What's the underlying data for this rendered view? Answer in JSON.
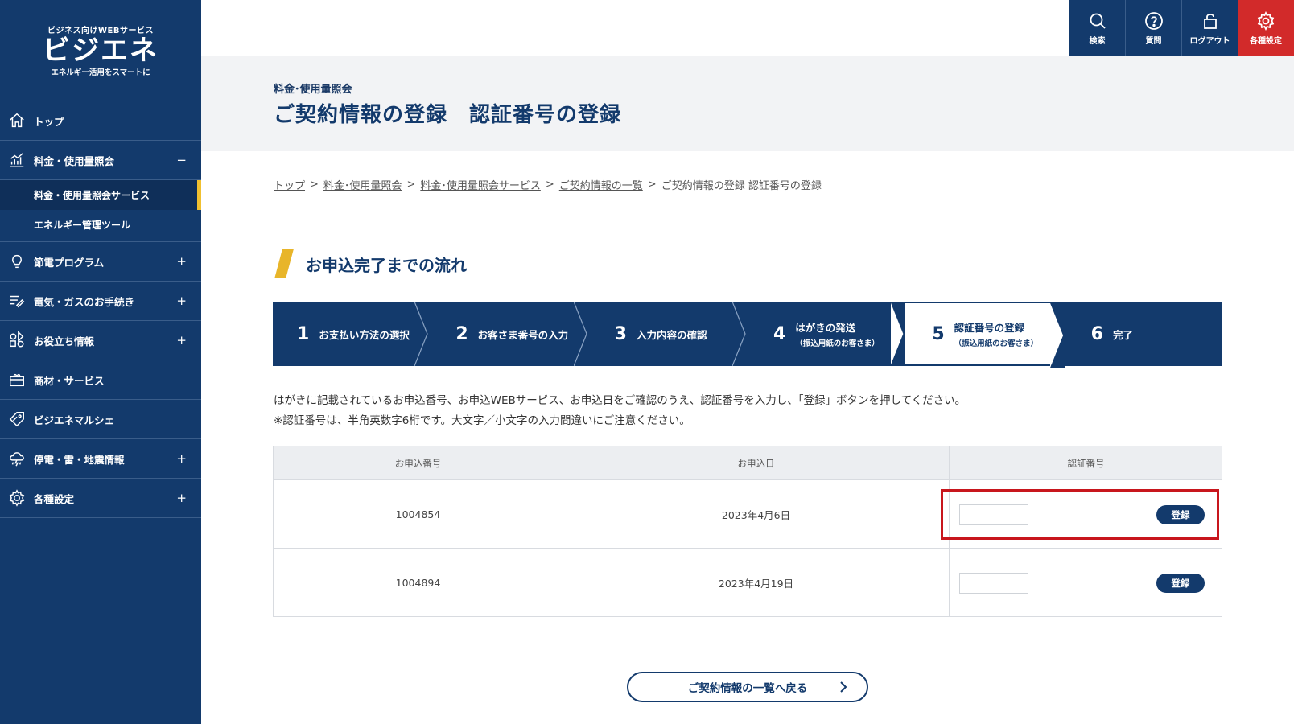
{
  "logo": {
    "top": "ビジネス向けWEBサービス",
    "main": "ビジエネ",
    "bottom": "エネルギー活用をスマートに"
  },
  "sidebar": {
    "items": [
      {
        "label": "トップ",
        "icon": "home-icon",
        "toggle": ""
      },
      {
        "label": "料金・使用量照会",
        "icon": "chart-icon",
        "toggle": "−"
      },
      {
        "label": "節電プログラム",
        "icon": "bulb-icon",
        "toggle": "+"
      },
      {
        "label": "電気・ガスのお手続き",
        "icon": "edit-list-icon",
        "toggle": "+"
      },
      {
        "label": "お役立ち情報",
        "icon": "grid-icon",
        "toggle": "+"
      },
      {
        "label": "商材・サービス",
        "icon": "box-icon",
        "toggle": ""
      },
      {
        "label": "ビジエネマルシェ",
        "icon": "tag-icon",
        "toggle": ""
      },
      {
        "label": "停電・雷・地震情報",
        "icon": "storm-icon",
        "toggle": "+"
      },
      {
        "label": "各種設定",
        "icon": "gear-icon",
        "toggle": "+"
      }
    ],
    "subitems": [
      {
        "label": "料金・使用量照会サービス",
        "active": true
      },
      {
        "label": "エネルギー管理ツール",
        "active": false
      }
    ]
  },
  "header": {
    "buttons": [
      {
        "label": "検索",
        "icon": "search-icon"
      },
      {
        "label": "質問",
        "icon": "question-icon"
      },
      {
        "label": "ログアウト",
        "icon": "lock-icon"
      },
      {
        "label": "各種設定",
        "icon": "gear-icon"
      }
    ]
  },
  "page": {
    "subtitle": "料金･使用量照会",
    "title": "ご契約情報の登録　認証番号の登録"
  },
  "breadcrumb": {
    "links": [
      "トップ",
      "料金･使用量照会",
      "料金･使用量照会サービス",
      "ご契約情報の一覧"
    ],
    "current": "ご契約情報の登録 認証番号の登録",
    "sep": ">"
  },
  "section": {
    "title": "お申込完了までの流れ"
  },
  "steps": [
    {
      "num": "1",
      "label": "お支払い方法の選択",
      "note": ""
    },
    {
      "num": "2",
      "label": "お客さま番号の入力",
      "note": ""
    },
    {
      "num": "3",
      "label": "入力内容の確認",
      "note": ""
    },
    {
      "num": "4",
      "label": "はがきの発送",
      "note": "（振込用紙のお客さま）"
    },
    {
      "num": "5",
      "label": "認証番号の登録",
      "note": "（振込用紙のお客さま）"
    },
    {
      "num": "6",
      "label": "完了",
      "note": ""
    }
  ],
  "instructions": {
    "line1": "はがきに記載されているお申込番号、お申込WEBサービス、お申込日をご確認のうえ、認証番号を入力し、「登録」ボタンを押してください。",
    "line2": "※認証番号は、半角英数字6桁です。大文字／小文字の入力間違いにご注意ください。"
  },
  "table": {
    "headers": [
      "お申込番号",
      "お申込日",
      "認証番号"
    ],
    "rows": [
      {
        "app_no": "1004854",
        "date": "2023年4月6日",
        "auth_value": "",
        "button": "登録"
      },
      {
        "app_no": "1004894",
        "date": "2023年4月19日",
        "auth_value": "",
        "button": "登録"
      }
    ]
  },
  "back_button": {
    "label": "ご契約情報の一覧へ戻る"
  },
  "colors": {
    "navy": "#133a6c",
    "accent": "#e8b52a",
    "red": "#d22a2a",
    "highlight": "#c8161d"
  }
}
